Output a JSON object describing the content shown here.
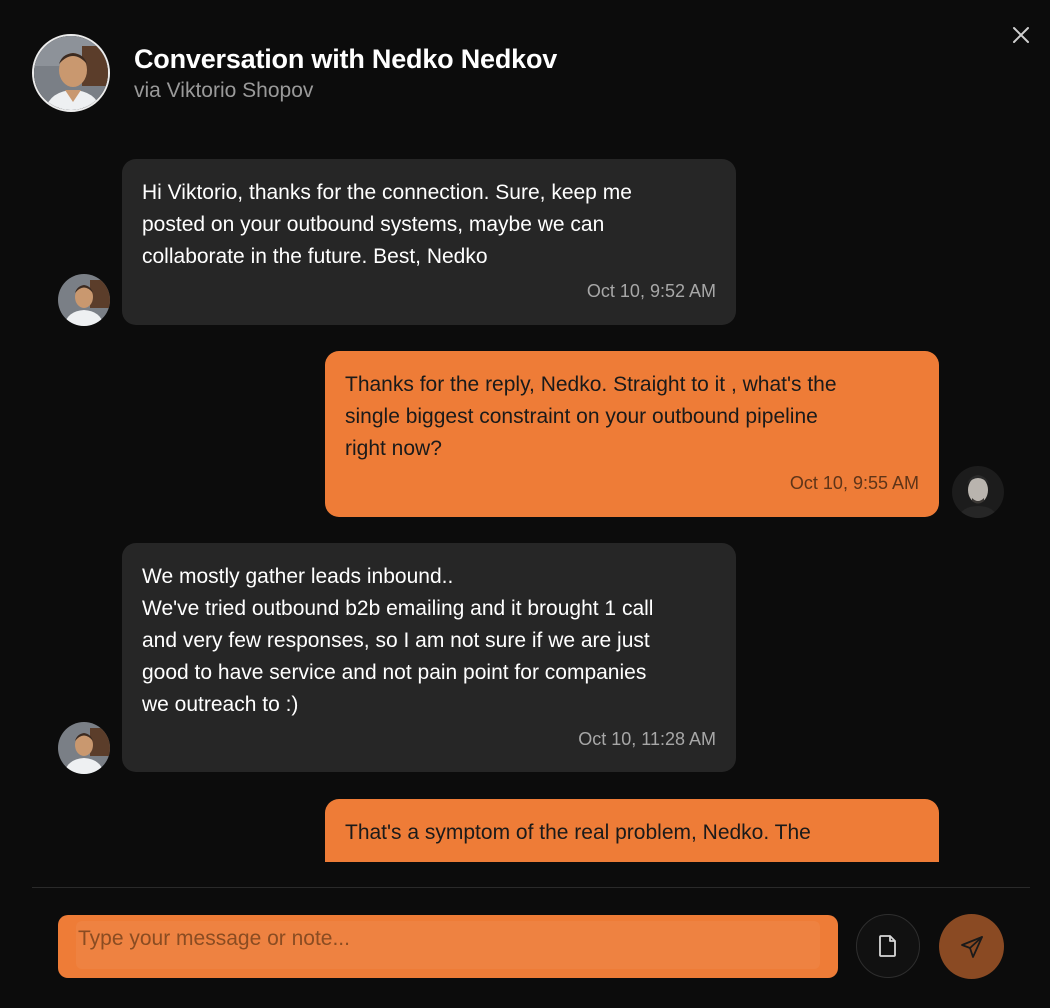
{
  "header": {
    "title": "Conversation with Nedko Nedkov",
    "subtitle": "via Viktorio Shopov",
    "avatar_icon": "contact-avatar-icon",
    "close_icon": "close-icon"
  },
  "messages": [
    {
      "direction": "in",
      "text": "Hi Viktorio, thanks for the connection. Sure, keep me\nposted on your outbound systems, maybe we can\ncollaborate in the future. Best, Nedko",
      "time": "Oct 10, 9:52 AM"
    },
    {
      "direction": "out",
      "text": "Thanks for the reply, Nedko. Straight to it ,  what's the\nsingle biggest constraint on your outbound pipeline\nright now?",
      "time": "Oct 10, 9:55 AM"
    },
    {
      "direction": "in",
      "text": "We mostly gather leads inbound..\nWe've tried outbound b2b emailing and it brought 1 call\nand very few responses, so I am not sure if we are just\ngood to have service and not pain point for companies\nwe outreach to :)",
      "time": "Oct 10, 11:28 AM"
    },
    {
      "direction": "out",
      "text": "That's a symptom of the real problem, Nedko. The",
      "time": ""
    }
  ],
  "composer": {
    "placeholder": "Type your message or note...",
    "value": "",
    "attach_icon": "file-icon",
    "send_icon": "send-icon"
  },
  "colors": {
    "background": "#0c0c0c",
    "incoming_bubble": "#262626",
    "outgoing_bubble": "#ee7c37",
    "send_button": "#8a4a23"
  }
}
